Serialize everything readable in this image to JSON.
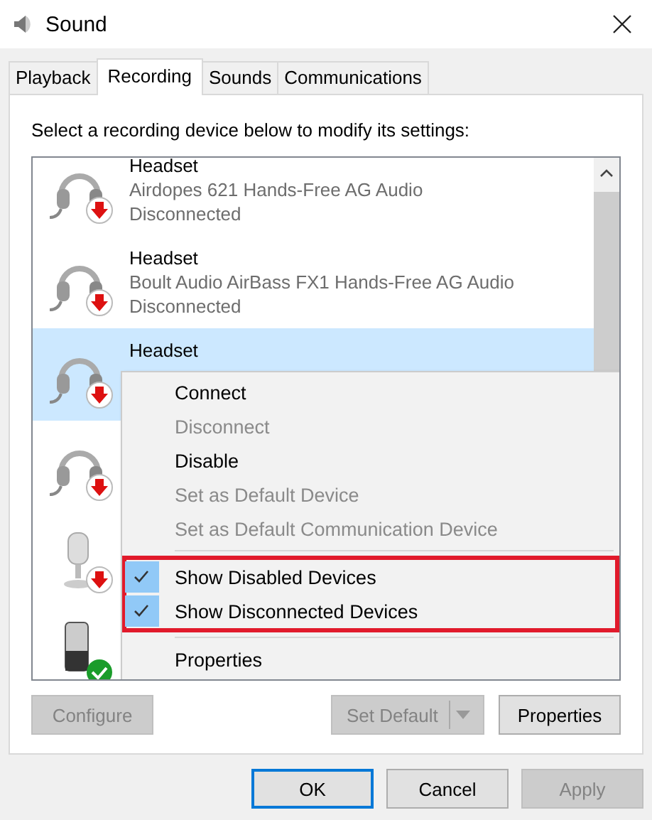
{
  "window": {
    "title": "Sound"
  },
  "tabs": [
    {
      "label": "Playback",
      "selected": false
    },
    {
      "label": "Recording",
      "selected": true
    },
    {
      "label": "Sounds",
      "selected": false
    },
    {
      "label": "Communications",
      "selected": false
    }
  ],
  "instruction": "Select a recording device below to modify its settings:",
  "devices": [
    {
      "kind": "headset",
      "disconnected": true,
      "name": "Headset",
      "detail": "Airdopes 621 Hands-Free AG Audio",
      "state_text": "Disconnected",
      "selected": false
    },
    {
      "kind": "headset",
      "disconnected": true,
      "name": "Headset",
      "detail": "Boult Audio AirBass FX1 Hands-Free AG Audio",
      "state_text": "Disconnected",
      "selected": false
    },
    {
      "kind": "headset",
      "disconnected": true,
      "name": "Headset",
      "selected": true
    },
    {
      "kind": "headset",
      "disconnected": true,
      "selected": false
    },
    {
      "kind": "microphone",
      "disconnected": true,
      "selected": false
    },
    {
      "kind": "dock",
      "disconnected": false,
      "selected": false
    }
  ],
  "context_menu": {
    "groups": [
      {
        "highlighted": false,
        "items": [
          {
            "label": "Connect",
            "disabled": false,
            "checked": false
          },
          {
            "label": "Disconnect",
            "disabled": true,
            "checked": false
          },
          {
            "label": "Disable",
            "disabled": false,
            "checked": false
          },
          {
            "label": "Set as Default Device",
            "disabled": true,
            "checked": false
          },
          {
            "label": "Set as Default Communication Device",
            "disabled": true,
            "checked": false
          }
        ]
      },
      {
        "highlighted": true,
        "items": [
          {
            "label": "Show Disabled Devices",
            "disabled": false,
            "checked": true
          },
          {
            "label": "Show Disconnected Devices",
            "disabled": false,
            "checked": true
          }
        ]
      },
      {
        "highlighted": false,
        "items": [
          {
            "label": "Properties",
            "disabled": false,
            "checked": false
          }
        ]
      }
    ]
  },
  "panel_buttons": {
    "configure": {
      "label": "Configure",
      "disabled": true
    },
    "set_default": {
      "label": "Set Default",
      "disabled": true
    },
    "properties": {
      "label": "Properties",
      "disabled": false
    }
  },
  "dialog_buttons": [
    {
      "label": "OK",
      "disabled": false,
      "default": true
    },
    {
      "label": "Cancel",
      "disabled": false,
      "default": false
    },
    {
      "label": "Apply",
      "disabled": true,
      "default": false
    }
  ]
}
